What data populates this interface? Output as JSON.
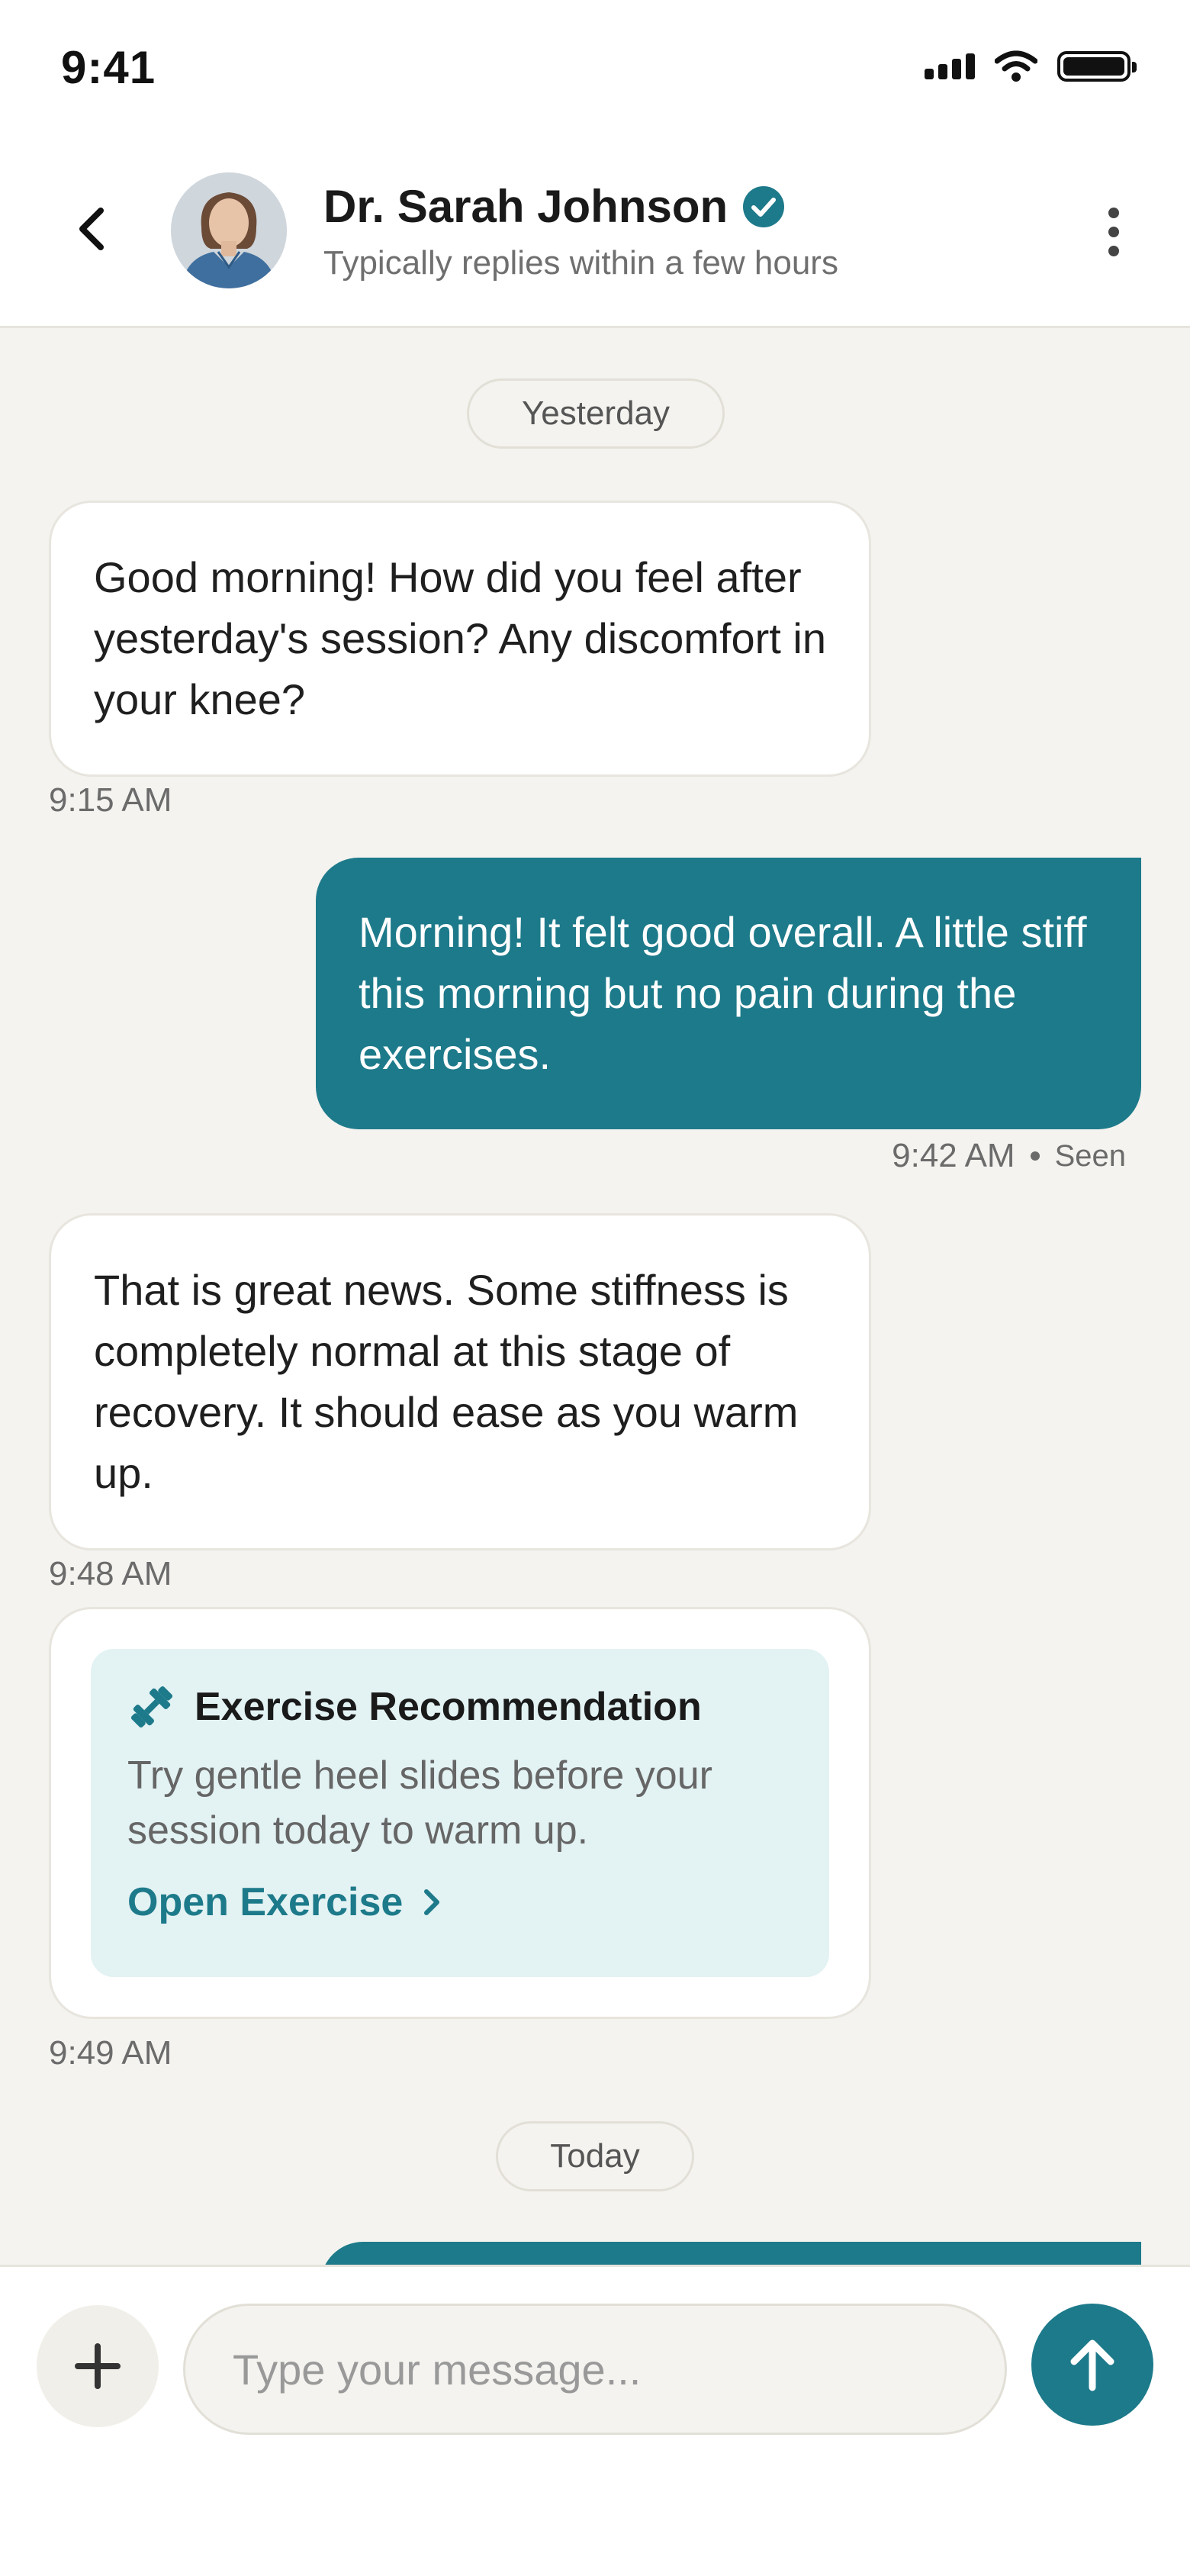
{
  "status_bar": {
    "time": "9:41"
  },
  "header": {
    "doctor_name": "Dr. Sarah Johnson",
    "subtitle": "Typically replies within a few hours"
  },
  "chat": {
    "date_yesterday": "Yesterday",
    "msg1": {
      "text": "Good morning! How did you feel after yesterday's session? Any discomfort in your knee?",
      "time": "9:15 AM"
    },
    "msg2": {
      "text": "Morning! It felt good overall. A little stiff this morning but no pain during the exercises.",
      "time": "9:42 AM",
      "status": "Seen"
    },
    "msg3": {
      "text": "That is great news. Some stiffness is completely normal at this stage of recovery. It should ease as you warm up.",
      "time": "9:48 AM"
    },
    "card": {
      "title": "Exercise Recommendation",
      "body": "Try gentle heel slides before your session today to warm up.",
      "link_label": "Open Exercise",
      "time": "9:49 AM"
    },
    "date_today": "Today"
  },
  "composer": {
    "placeholder": "Type your message..."
  },
  "colors": {
    "accent": "#1d7a8a",
    "background": "#f4f3ef",
    "card_tint": "#e3f2f3"
  },
  "icons": [
    "back-arrow-icon",
    "verified-badge-icon",
    "more-vertical-icon",
    "dumbbell-icon",
    "chevron-right-icon",
    "plus-icon",
    "arrow-up-icon",
    "signal-icon",
    "wifi-icon",
    "battery-icon"
  ]
}
